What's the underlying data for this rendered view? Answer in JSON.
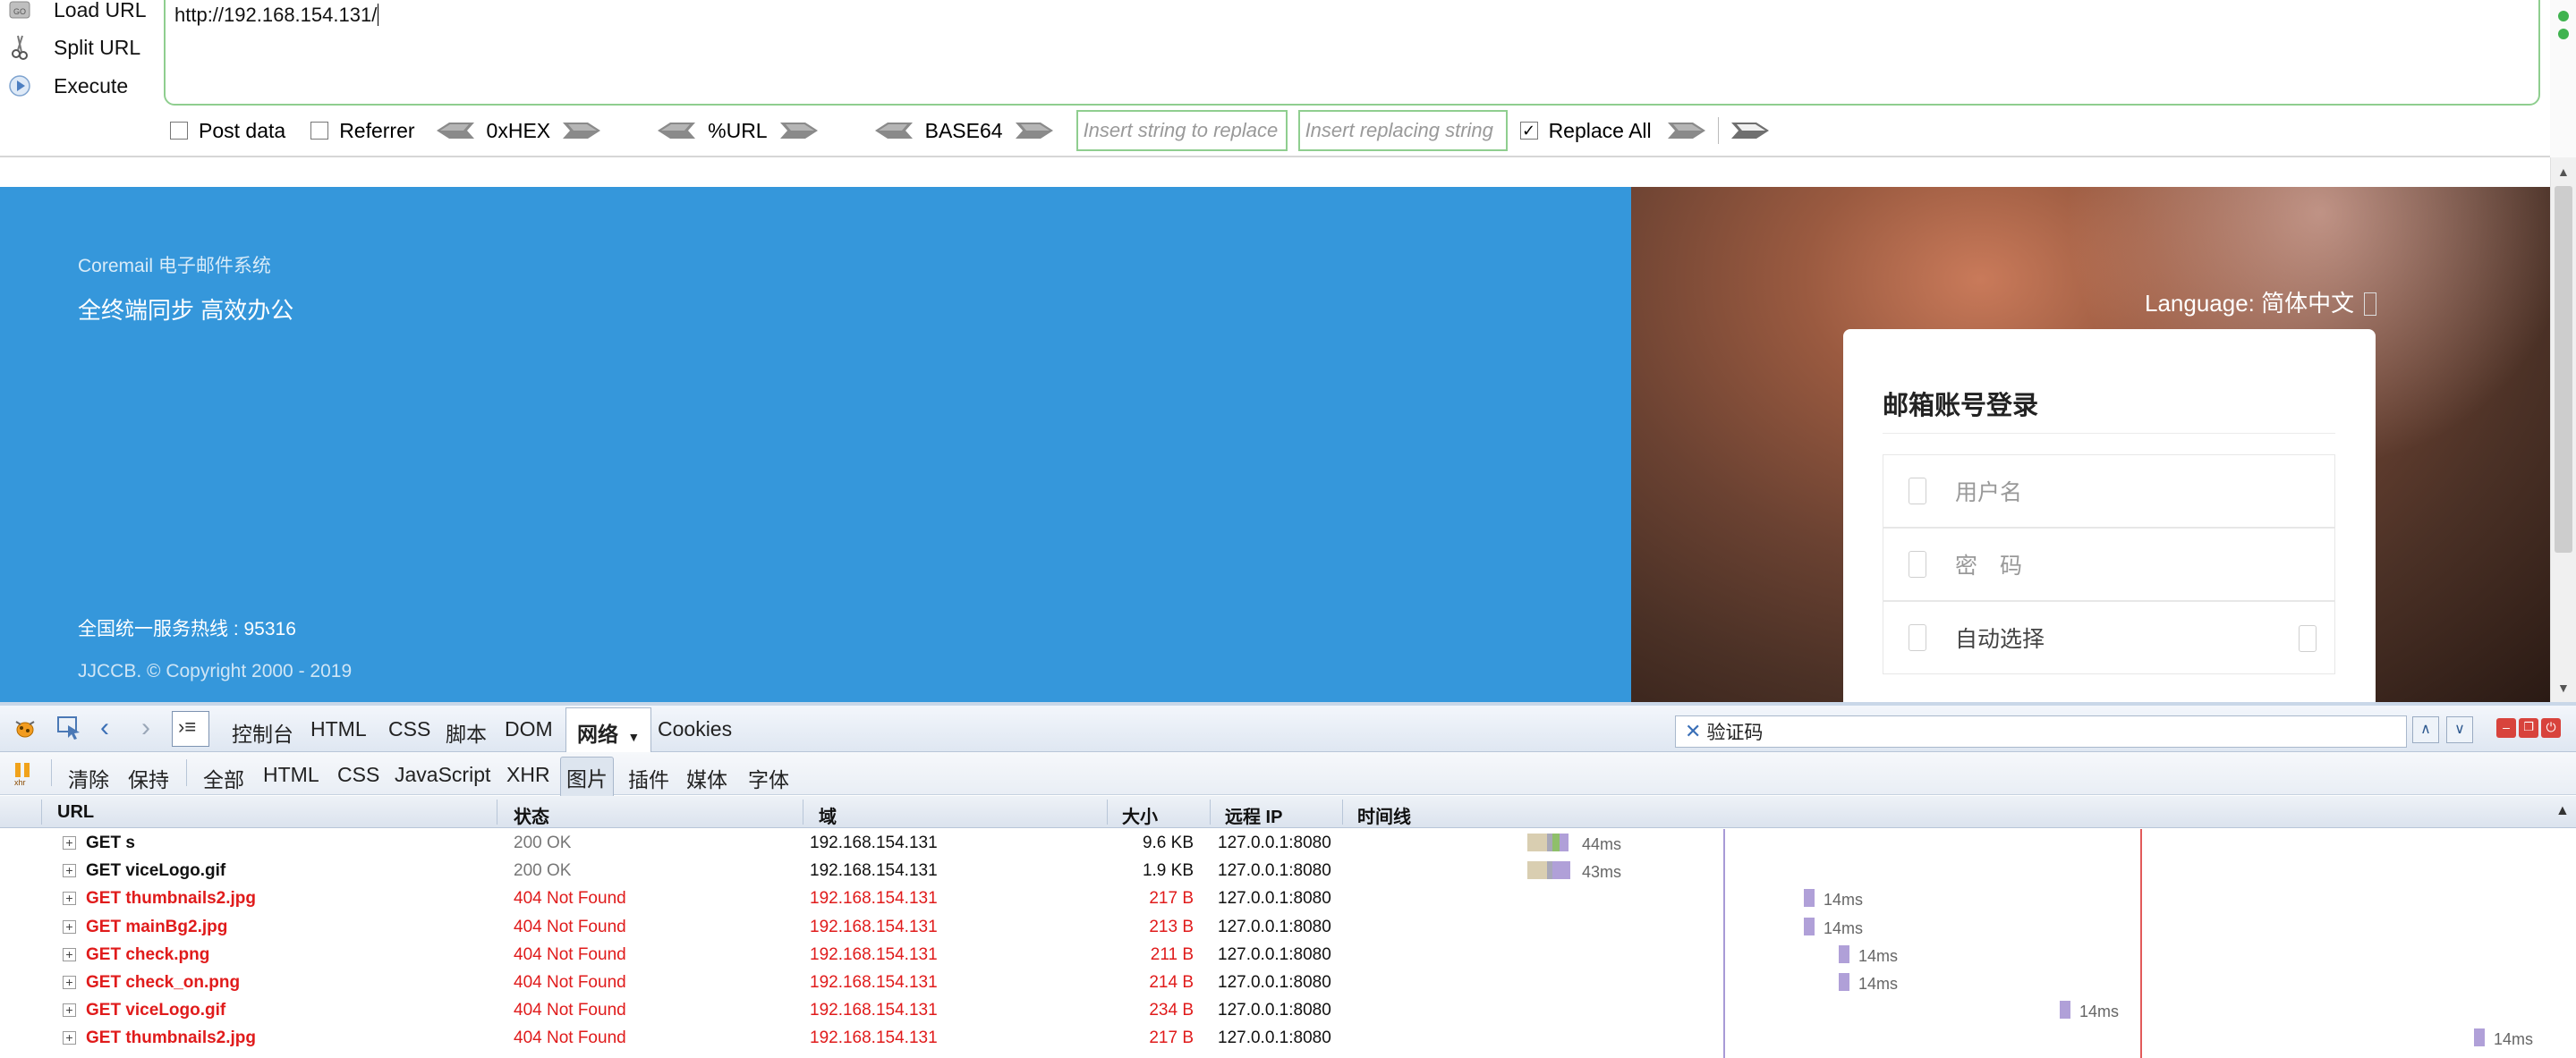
{
  "hackbar": {
    "actions": [
      {
        "label": "Load URL",
        "icon": "load-url-icon"
      },
      {
        "label": "Split URL",
        "icon": "split-url-icon"
      },
      {
        "label": "Execute",
        "icon": "execute-icon"
      }
    ],
    "url_value": "http://192.168.154.131/",
    "options": {
      "post_data": "Post data",
      "referrer": "Referrer",
      "hex": "0xHEX",
      "url_encode": "%URL",
      "base64": "BASE64",
      "insert_string_placeholder": "Insert string to replace",
      "insert_replacing_placeholder": "Insert replacing string",
      "replace_all": "Replace All"
    }
  },
  "page": {
    "brand": "Coremail 电子邮件系统",
    "slogan": "全终端同步 高效办公",
    "hotline": "全国统一服务热线 : 95316",
    "copyright": "JJCCB. © Copyright 2000 - 2019",
    "language_label": "Language: 简体中文",
    "login": {
      "title": "邮箱账号登录",
      "username_placeholder": "用户名",
      "password_placeholder": "密　码",
      "auto_select": "自动选择"
    }
  },
  "firebug": {
    "tabs": [
      "控制台",
      "HTML",
      "CSS",
      "脚本",
      "DOM",
      "网络",
      "Cookies"
    ],
    "active_tab": "网络",
    "search_value": "验证码",
    "filters": {
      "clear": "清除",
      "persist": "保持",
      "types": [
        "全部",
        "HTML",
        "CSS",
        "JavaScript",
        "XHR",
        "图片",
        "插件",
        "媒体",
        "字体"
      ],
      "active_type": "图片"
    },
    "columns": {
      "url": "URL",
      "status": "状态",
      "domain": "域",
      "size": "大小",
      "remote_ip": "远程 IP",
      "timeline": "时间线"
    },
    "requests": [
      {
        "method_url": "GET s",
        "status": "200 OK",
        "domain": "192.168.154.131",
        "size": "9.6 KB",
        "ip": "127.0.0.1:8080",
        "time": "44ms",
        "error": false
      },
      {
        "method_url": "GET viceLogo.gif",
        "status": "200 OK",
        "domain": "192.168.154.131",
        "size": "1.9 KB",
        "ip": "127.0.0.1:8080",
        "time": "43ms",
        "error": false
      },
      {
        "method_url": "GET thumbnails2.jpg",
        "status": "404 Not Found",
        "domain": "192.168.154.131",
        "size": "217 B",
        "ip": "127.0.0.1:8080",
        "time": "14ms",
        "error": true
      },
      {
        "method_url": "GET mainBg2.jpg",
        "status": "404 Not Found",
        "domain": "192.168.154.131",
        "size": "213 B",
        "ip": "127.0.0.1:8080",
        "time": "14ms",
        "error": true
      },
      {
        "method_url": "GET check.png",
        "status": "404 Not Found",
        "domain": "192.168.154.131",
        "size": "211 B",
        "ip": "127.0.0.1:8080",
        "time": "14ms",
        "error": true
      },
      {
        "method_url": "GET check_on.png",
        "status": "404 Not Found",
        "domain": "192.168.154.131",
        "size": "214 B",
        "ip": "127.0.0.1:8080",
        "time": "14ms",
        "error": true
      },
      {
        "method_url": "GET viceLogo.gif",
        "status": "404 Not Found",
        "domain": "192.168.154.131",
        "size": "234 B",
        "ip": "127.0.0.1:8080",
        "time": "14ms",
        "error": true
      },
      {
        "method_url": "GET thumbnails2.jpg",
        "status": "404 Not Found",
        "domain": "192.168.154.131",
        "size": "217 B",
        "ip": "127.0.0.1:8080",
        "time": "14ms",
        "error": true
      }
    ]
  },
  "colors": {
    "page_blue": "#3597db",
    "error_red": "#e01b1b",
    "hackbar_green": "#8fce8f"
  }
}
